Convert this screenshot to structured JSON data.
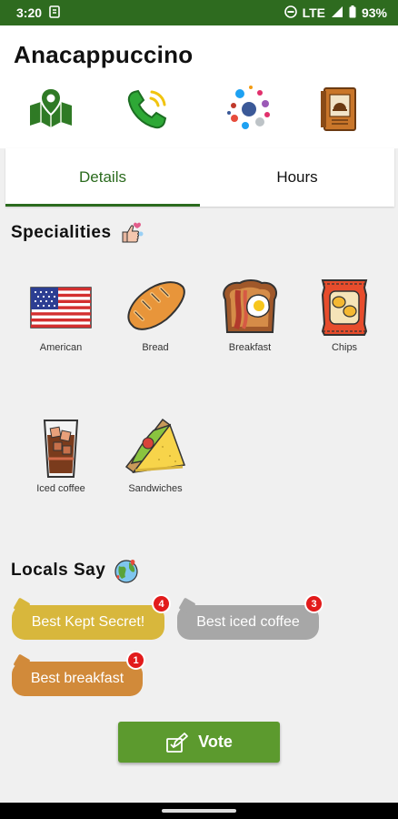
{
  "status_bar": {
    "time": "3:20",
    "network": "LTE",
    "battery": "93%"
  },
  "app": {
    "title": "Anacappuccino"
  },
  "actions": [
    {
      "icon": "map-pin-icon"
    },
    {
      "icon": "phone-icon"
    },
    {
      "icon": "social-icon"
    },
    {
      "icon": "menu-book-icon"
    }
  ],
  "tabs": [
    {
      "label": "Details",
      "active": true
    },
    {
      "label": "Hours",
      "active": false
    }
  ],
  "specialities": {
    "title": "Specialities",
    "items": [
      {
        "label": "American",
        "icon": "usa-flag-icon"
      },
      {
        "label": "Bread",
        "icon": "bread-icon"
      },
      {
        "label": "Breakfast",
        "icon": "breakfast-icon"
      },
      {
        "label": "Chips",
        "icon": "chips-icon"
      },
      {
        "label": "Iced coffee",
        "icon": "iced-coffee-icon"
      },
      {
        "label": "Sandwiches",
        "icon": "sandwich-icon"
      }
    ]
  },
  "locals": {
    "title": "Locals Say",
    "tags": [
      {
        "label": "Best Kept Secret!",
        "count": "4",
        "color": "#d8b73c"
      },
      {
        "label": "Best iced coffee",
        "count": "3",
        "color": "#a7a7a7"
      },
      {
        "label": "Best breakfast",
        "count": "1",
        "color": "#d18a3a"
      }
    ]
  },
  "vote": {
    "label": "Vote"
  },
  "colors": {
    "status_bar": "#2e6b1f",
    "accent": "#2b6b1e",
    "vote": "#5c9a2e",
    "badge": "#e21b1b"
  }
}
